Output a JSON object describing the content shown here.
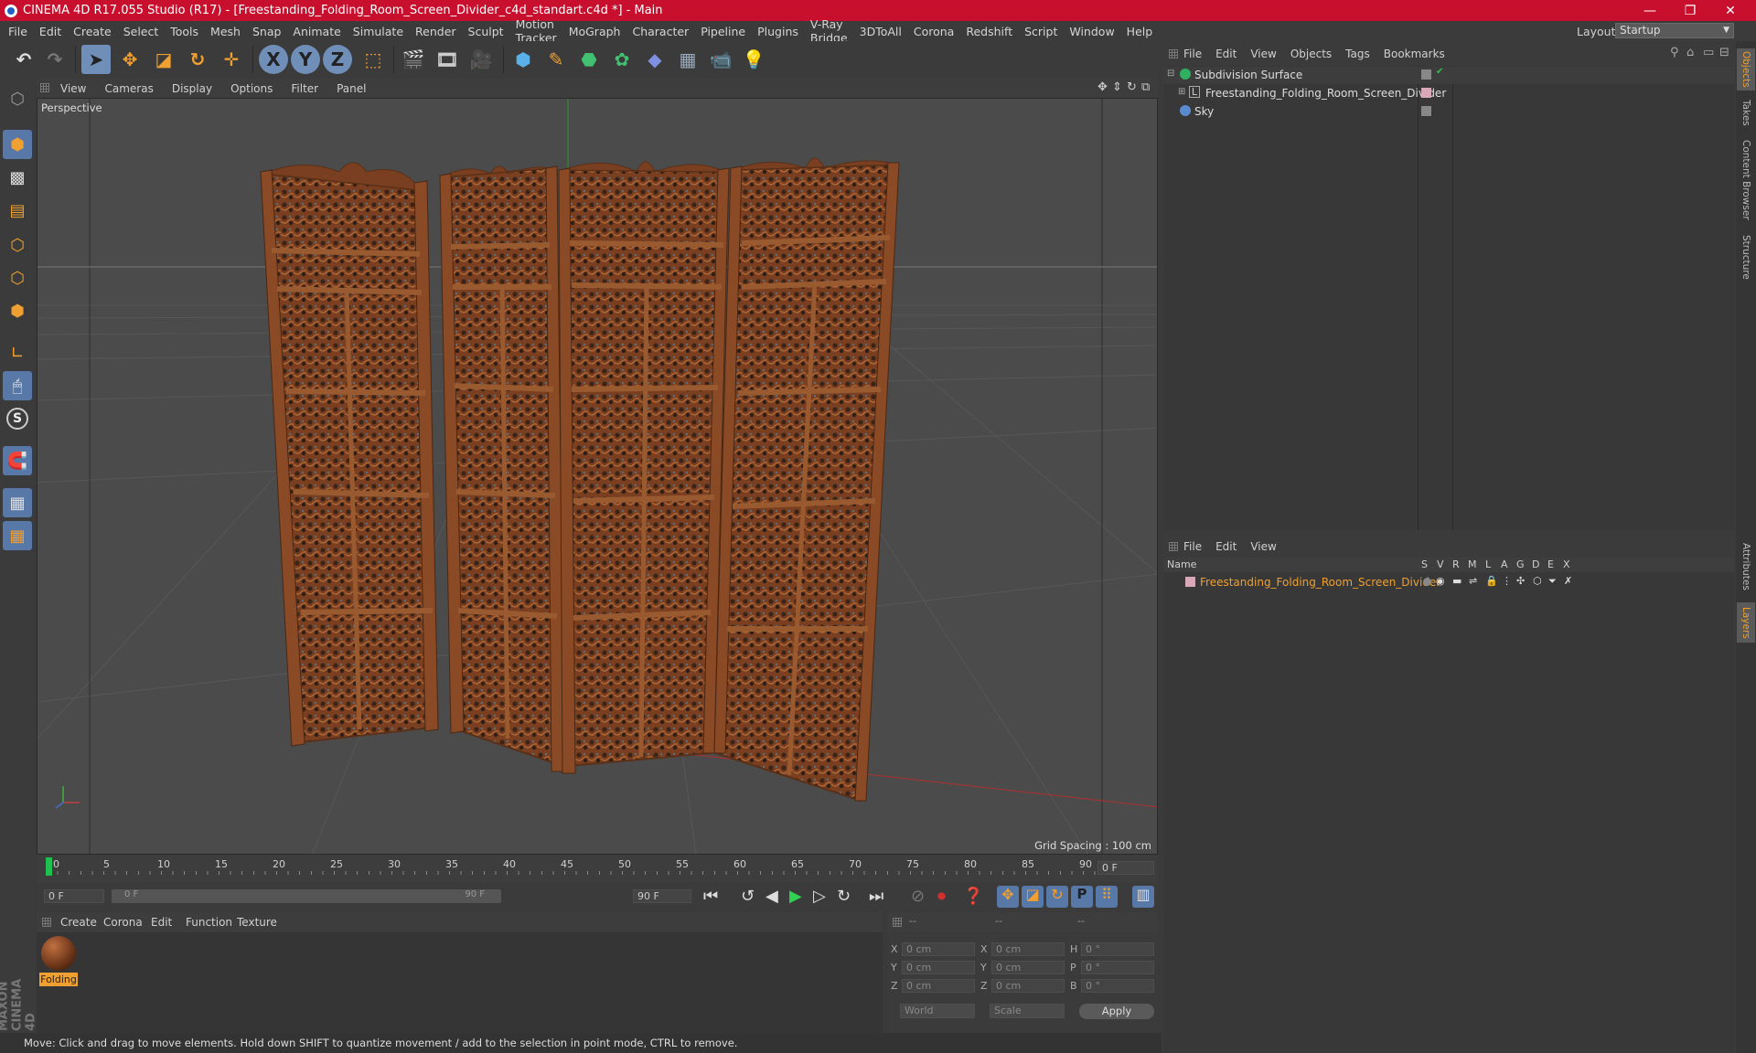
{
  "window": {
    "title": "CINEMA 4D R17.055 Studio (R17) - [Freestanding_Folding_Room_Screen_Divider_c4d_standart.c4d *] - Main",
    "minimize": "—",
    "maximize": "❐",
    "close": "✕"
  },
  "menubar": {
    "items": [
      "File",
      "Edit",
      "Create",
      "Select",
      "Tools",
      "Mesh",
      "Snap",
      "Animate",
      "Simulate",
      "Render",
      "Sculpt",
      "Motion Tracker",
      "MoGraph",
      "Character",
      "Pipeline",
      "Plugins",
      "V-Ray Bridge",
      "3DToAll",
      "Corona",
      "Redshift",
      "Script",
      "Window",
      "Help"
    ]
  },
  "layout": {
    "label": "Layout:",
    "value": "Startup"
  },
  "toolbar": {
    "x_label": "X",
    "y_label": "Y",
    "z_label": "Z"
  },
  "viewport": {
    "menu": [
      "View",
      "Cameras",
      "Display",
      "Options",
      "Filter",
      "Panel"
    ],
    "camera": "Perspective",
    "grid_spacing": "Grid Spacing : 100 cm"
  },
  "timeline": {
    "ticks": [
      "0",
      "5",
      "10",
      "15",
      "20",
      "25",
      "30",
      "35",
      "40",
      "45",
      "50",
      "55",
      "60",
      "65",
      "70",
      "75",
      "80",
      "85",
      "90"
    ],
    "current_frame": "0 F",
    "start_field": "0 F",
    "range_start": "0 F",
    "range_end": "90 F",
    "end_field": "90 F"
  },
  "materials": {
    "menu": [
      "Create",
      "Corona",
      "Edit",
      "Function",
      "Texture"
    ],
    "items": [
      {
        "name": "Folding"
      }
    ]
  },
  "coords": {
    "header1": "--",
    "header2": "--",
    "header3": "--",
    "rows": [
      {
        "a": "X",
        "av": "0 cm",
        "b": "X",
        "bv": "0 cm",
        "c": "H",
        "cv": "0 °"
      },
      {
        "a": "Y",
        "av": "0 cm",
        "b": "Y",
        "bv": "0 cm",
        "c": "P",
        "cv": "0 °"
      },
      {
        "a": "Z",
        "av": "0 cm",
        "b": "Z",
        "bv": "0 cm",
        "c": "B",
        "cv": "0 °"
      }
    ],
    "mode1": "World",
    "mode2": "Scale",
    "apply": "Apply"
  },
  "status": {
    "text": "Move: Click and drag to move elements. Hold down SHIFT to quantize movement / add to the selection in point mode, CTRL to remove."
  },
  "objects": {
    "menu": [
      "File",
      "Edit",
      "View",
      "Objects",
      "Tags",
      "Bookmarks"
    ],
    "items": [
      {
        "name": "Subdivision Surface"
      },
      {
        "name": "Freestanding_Folding_Room_Screen_Divider"
      },
      {
        "name": "Sky"
      }
    ]
  },
  "layers": {
    "menu": [
      "File",
      "Edit",
      "View"
    ],
    "columns": [
      "Name",
      "S",
      "V",
      "R",
      "M",
      "L",
      "A",
      "G",
      "D",
      "E",
      "X"
    ],
    "items": [
      {
        "name": "Freestanding_Folding_Room_Screen_Divider",
        "color": "#f0a030"
      }
    ]
  },
  "sidetabs": [
    "Objects",
    "Takes",
    "Content Browser",
    "Structure",
    "Attributes",
    "Layers"
  ],
  "brand": "MAXON CINEMA 4D",
  "colors": {
    "title_bar": "#c8102e",
    "accent_orange": "#f0a030",
    "active_tool": "#6f8fb8",
    "wood": "#8a4a26"
  }
}
